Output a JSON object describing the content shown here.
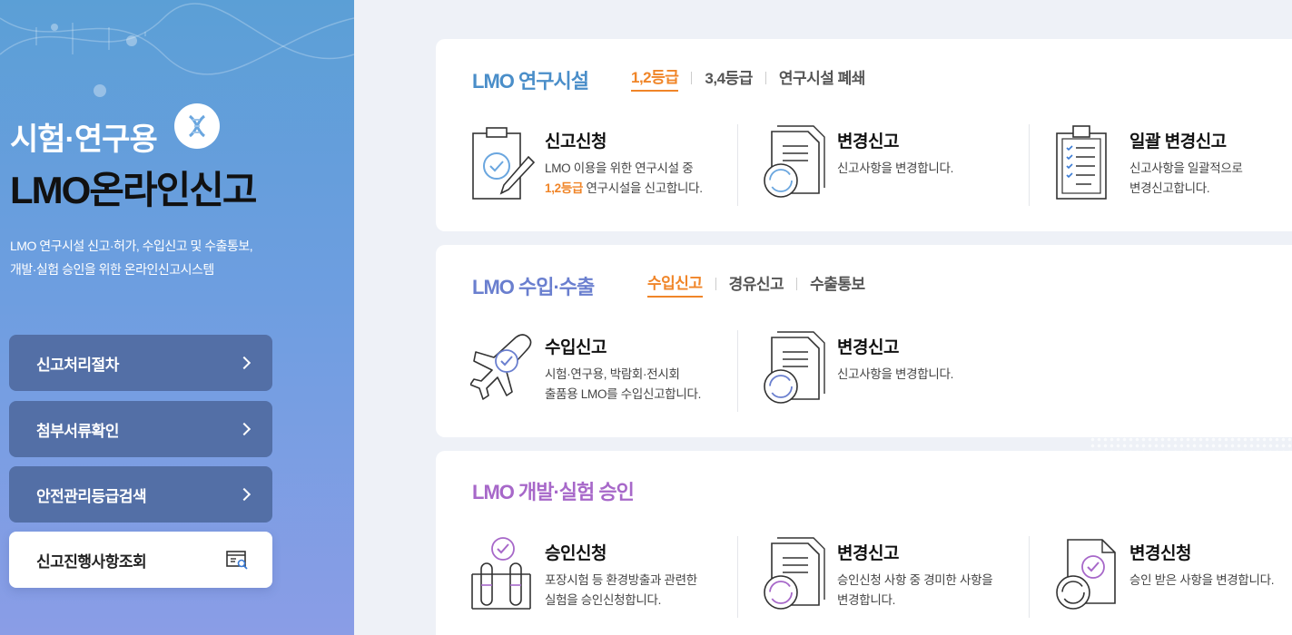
{
  "sidebar": {
    "title_line1": "시험·연구용",
    "title_line2": "LMO온라인신고",
    "desc_line1": "LMO 연구시설 신고·허가, 수입신고 및 수출통보,",
    "desc_line2": "개발·실험 승인을 위한 온라인신고시스템",
    "menu": [
      {
        "label": "신고처리절차",
        "icon": "chevron-right-icon"
      },
      {
        "label": "첨부서류확인",
        "icon": "chevron-right-icon"
      },
      {
        "label": "안전관리등급검색",
        "icon": "chevron-right-icon"
      },
      {
        "label": "신고진행사항조회",
        "icon": "document-search-icon"
      }
    ]
  },
  "cards": [
    {
      "title": "LMO 연구시설",
      "title_color": "#4a8ec9",
      "tabs": [
        "1,2등급",
        "3,4등급",
        "연구시설 폐쇄"
      ],
      "items": [
        {
          "title": "신고신청",
          "desc1": "LMO 이용을 위한 연구시설 중",
          "desc2_hl": "1,2등급",
          "desc2": " 연구시설을 신고합니다.",
          "icon": "clipboard-pen-icon"
        },
        {
          "title": "변경신고",
          "desc1": "신고사항을 변경합니다.",
          "desc2": "",
          "icon": "document-refresh-icon"
        },
        {
          "title": "일괄 변경신고",
          "desc1": "신고사항을 일괄적으로",
          "desc2": "변경신고합니다.",
          "icon": "checklist-clipboard-icon"
        }
      ]
    },
    {
      "title": "LMO 수입·수출",
      "title_color": "#6a7fcf",
      "tabs": [
        "수입신고",
        "경유신고",
        "수출통보"
      ],
      "items": [
        {
          "title": "수입신고",
          "desc1": "시험·연구용, 박람회·전시회",
          "desc2": "출품용 LMO를 수입신고합니다.",
          "icon": "airplane-check-icon"
        },
        {
          "title": "변경신고",
          "desc1": "신고사항을 변경합니다.",
          "desc2": "",
          "icon": "document-refresh-icon"
        }
      ]
    },
    {
      "title": "LMO 개발·실험 승인",
      "title_color": "#a768c9",
      "items": [
        {
          "title": "승인신청",
          "desc1": "포장시험 등 환경방출과 관련한",
          "desc2": "실험을 승인신청합니다.",
          "icon": "test-tubes-check-icon"
        },
        {
          "title": "변경신고",
          "desc1": "승인신청 사항 중 경미한 사항을",
          "desc2": "변경합니다.",
          "icon": "document-refresh-icon"
        },
        {
          "title": "변경신청",
          "desc1": "승인 받은 사항을 변경합니다.",
          "desc2": "",
          "icon": "document-check-refresh-icon"
        }
      ]
    }
  ],
  "colors": {
    "accent": "#f08528",
    "menu_bg": "#536fa6"
  }
}
